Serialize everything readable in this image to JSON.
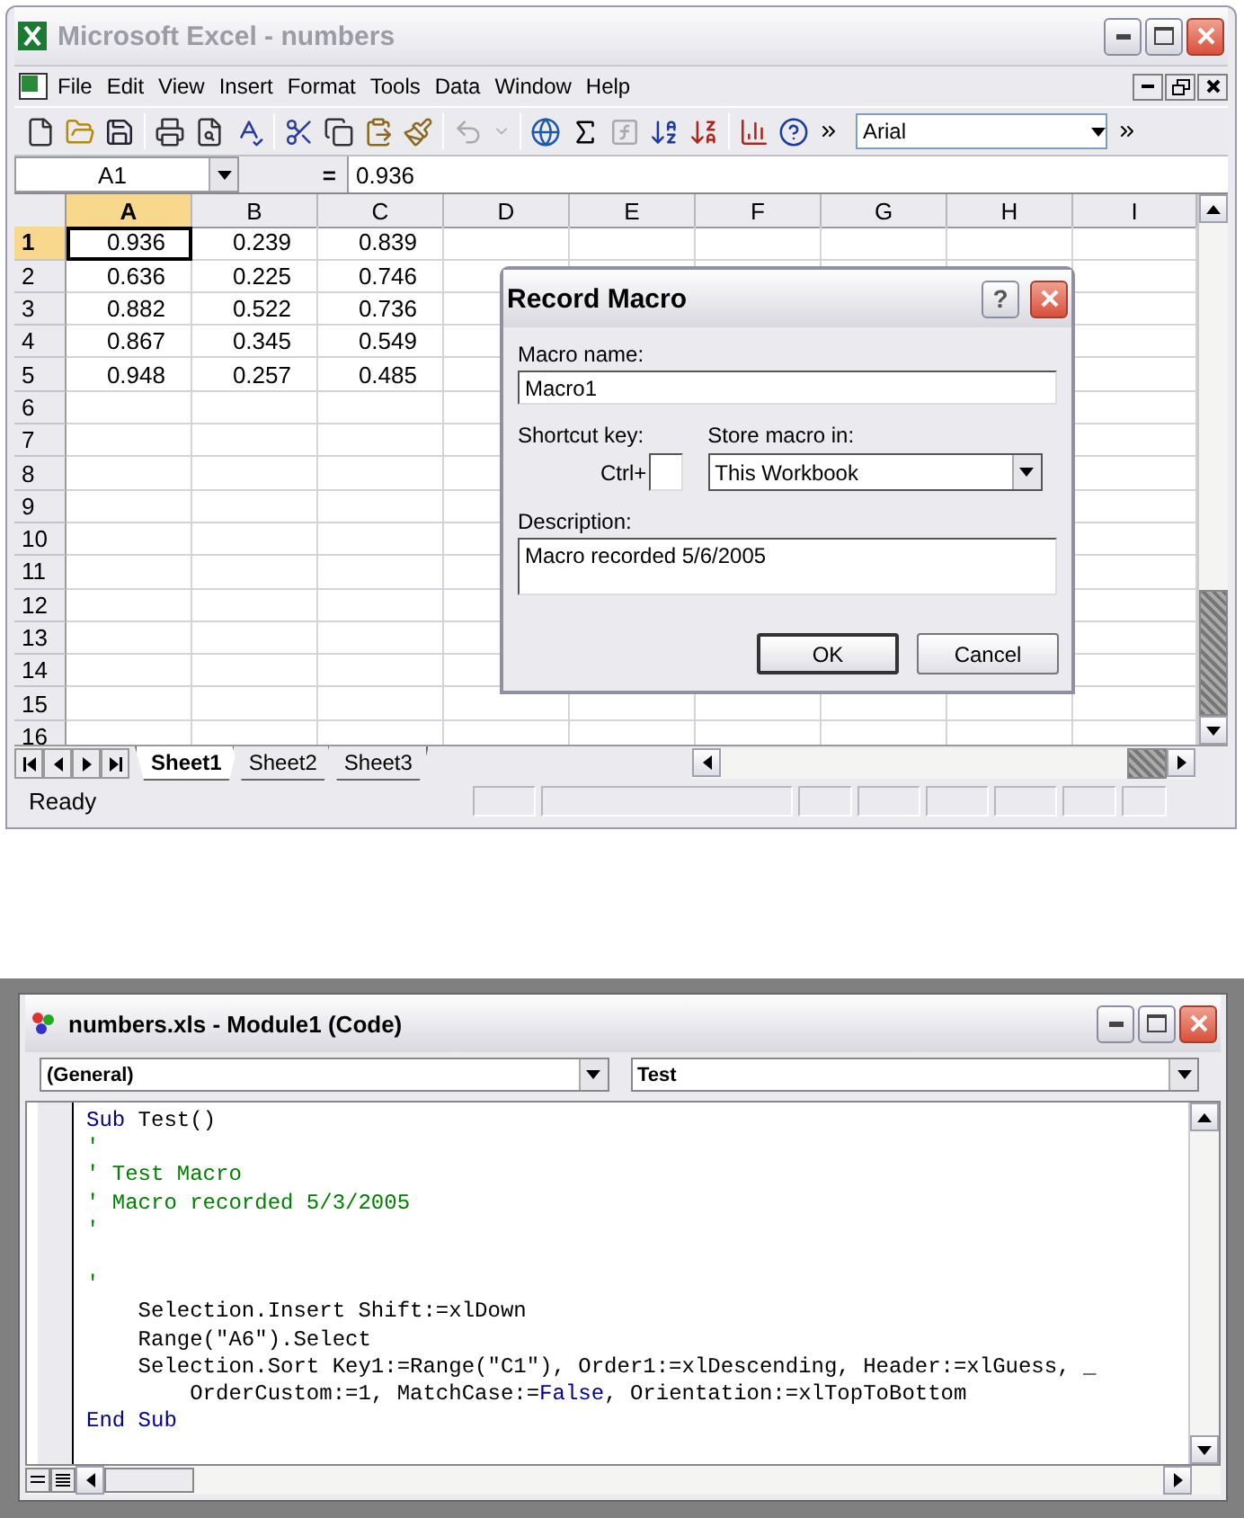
{
  "excel": {
    "title": "Microsoft Excel - numbers",
    "menu": [
      "File",
      "Edit",
      "View",
      "Insert",
      "Format",
      "Tools",
      "Data",
      "Window",
      "Help"
    ],
    "font_box": "Arial",
    "name_box": "A1",
    "formula_equals": "=",
    "formula": "0.936",
    "columns": [
      {
        "label": "A",
        "selected": true
      },
      {
        "label": "B",
        "selected": false
      },
      {
        "label": "C",
        "selected": false
      },
      {
        "label": "D",
        "selected": false
      },
      {
        "label": "E",
        "selected": false
      },
      {
        "label": "F",
        "selected": false
      },
      {
        "label": "G",
        "selected": false
      },
      {
        "label": "H",
        "selected": false
      },
      {
        "label": "I",
        "selected": false
      }
    ],
    "rows": [
      {
        "header": "1",
        "selected": true,
        "cells": [
          {
            "text": "0.936",
            "selected": true
          },
          {
            "text": "0.239",
            "selected": false
          },
          {
            "text": "0.839",
            "selected": false
          }
        ]
      },
      {
        "header": "2",
        "selected": false,
        "cells": [
          {
            "text": "0.636",
            "selected": false
          },
          {
            "text": "0.225",
            "selected": false
          },
          {
            "text": "0.746",
            "selected": false
          }
        ]
      },
      {
        "header": "3",
        "selected": false,
        "cells": [
          {
            "text": "0.882",
            "selected": false
          },
          {
            "text": "0.522",
            "selected": false
          },
          {
            "text": "0.736",
            "selected": false
          }
        ]
      },
      {
        "header": "4",
        "selected": false,
        "cells": [
          {
            "text": "0.867",
            "selected": false
          },
          {
            "text": "0.345",
            "selected": false
          },
          {
            "text": "0.549",
            "selected": false
          }
        ]
      },
      {
        "header": "5",
        "selected": false,
        "cells": [
          {
            "text": "0.948",
            "selected": false
          },
          {
            "text": "0.257",
            "selected": false
          },
          {
            "text": "0.485",
            "selected": false
          }
        ]
      },
      {
        "header": "6",
        "selected": false
      },
      {
        "header": "7",
        "selected": false
      },
      {
        "header": "8",
        "selected": false
      },
      {
        "header": "9",
        "selected": false
      },
      {
        "header": "10",
        "selected": false
      },
      {
        "header": "11",
        "selected": false
      },
      {
        "header": "12",
        "selected": false
      },
      {
        "header": "13",
        "selected": false
      },
      {
        "header": "14",
        "selected": false
      },
      {
        "header": "15",
        "selected": false
      },
      {
        "header": "16",
        "selected": false
      }
    ],
    "sheet_tabs": [
      {
        "label": "Sheet1",
        "selected": true
      },
      {
        "label": "Sheet2",
        "selected": false
      },
      {
        "label": "Sheet3",
        "selected": false
      }
    ],
    "status": "Ready"
  },
  "dialog": {
    "title": "Record Macro",
    "help": "?",
    "macro_name_label": "Macro name:",
    "macro_name": "Macro1",
    "shortcut_label": "Shortcut key:",
    "ctrl": "Ctrl+",
    "store_label": "Store macro in:",
    "store_value": "This Workbook",
    "description_label": "Description:",
    "description": "Macro recorded 5/6/2005",
    "buttons": [
      "OK",
      "Cancel"
    ]
  },
  "vba": {
    "title": "numbers.xls - Module1 (Code)",
    "object_box": "(General)",
    "procedure_box": "Test",
    "lines": [
      {
        "kind": "code",
        "segments": [
          {
            "kind": "keyword",
            "text": "Sub"
          },
          {
            "kind": "plain",
            "text": " Test()"
          }
        ]
      },
      {
        "kind": "code",
        "segments": [
          {
            "kind": "comment",
            "text": "'"
          }
        ]
      },
      {
        "kind": "code",
        "segments": [
          {
            "kind": "comment",
            "text": "' Test Macro"
          }
        ]
      },
      {
        "kind": "code",
        "segments": [
          {
            "kind": "comment",
            "text": "' Macro recorded 5/3/2005"
          }
        ]
      },
      {
        "kind": "code",
        "segments": [
          {
            "kind": "comment",
            "text": "'"
          }
        ]
      },
      {
        "kind": "blank"
      },
      {
        "kind": "code",
        "segments": [
          {
            "kind": "comment",
            "text": "'"
          }
        ]
      },
      {
        "kind": "code",
        "segments": [
          {
            "kind": "plain",
            "text": "    Selection.Insert Shift:=xlDown"
          }
        ]
      },
      {
        "kind": "code",
        "segments": [
          {
            "kind": "plain",
            "text": "    Range(\"A6\").Select"
          }
        ]
      },
      {
        "kind": "code",
        "segments": [
          {
            "kind": "plain",
            "text": "    Selection.Sort Key1:=Range(\"C1\"), Order1:=xlDescending, Header:=xlGuess, _"
          }
        ]
      },
      {
        "kind": "code",
        "segments": [
          {
            "kind": "plain",
            "text": "        OrderCustom:=1, MatchCase:="
          },
          {
            "kind": "keyword",
            "text": "False"
          },
          {
            "kind": "plain",
            "text": ", Orientation:=xlTopToBottom"
          }
        ]
      },
      {
        "kind": "code",
        "segments": [
          {
            "kind": "keyword",
            "text": "End Sub"
          }
        ]
      }
    ]
  }
}
